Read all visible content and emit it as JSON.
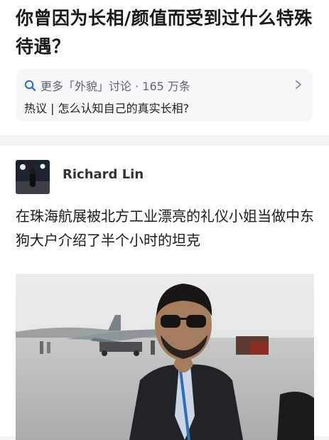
{
  "question": {
    "title": "你曾因为长相/颜值而受到过什么特殊待遇？"
  },
  "topic": {
    "discussion": "更多「外貌」讨论 · 165 万条",
    "hot_topic": "热议 | 怎么认知自己的真实长相?",
    "icon": "search-icon"
  },
  "answer": {
    "author": "Richard Lin",
    "text": "在珠海航展被北方工业漂亮的礼仪小姐当做中东狗大户介绍了半个小时的坦克"
  },
  "colors": {
    "page_bg": "#f3f4f6",
    "card_bg": "#ffffff",
    "topic_bg": "#f6f7f9",
    "icon_blue": "#2a6fd6"
  }
}
